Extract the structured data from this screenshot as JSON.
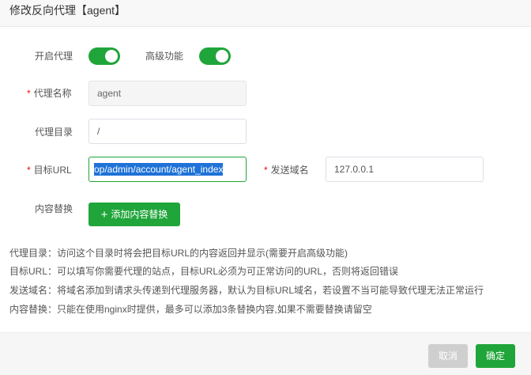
{
  "dialog": {
    "title": "修改反向代理【agent】"
  },
  "form": {
    "enable_proxy": {
      "label": "开启代理",
      "on": true
    },
    "advanced": {
      "label": "高级功能",
      "on": true
    },
    "proxy_name": {
      "label": "代理名称",
      "required_mark": "*",
      "value": "agent"
    },
    "proxy_dir": {
      "label": "代理目录",
      "value": "/"
    },
    "target_url": {
      "label": "目标URL",
      "required_mark": "*",
      "value": "op/admin/account/agent_index"
    },
    "send_domain": {
      "label": "发送域名",
      "required_mark": "*",
      "value": "127.0.0.1"
    },
    "content_replace": {
      "label": "内容替换",
      "add_button": "添加内容替换",
      "add_icon": "+"
    }
  },
  "help": [
    "代理目录：访问这个目录时将会把目标URL的内容返回并显示(需要开启高级功能)",
    "目标URL：可以填写你需要代理的站点，目标URL必须为可正常访问的URL，否则将返回错误",
    "发送域名：将域名添加到请求头传递到代理服务器，默认为目标URL域名，若设置不当可能导致代理无法正常运行",
    "内容替换：只能在使用nginx时提供，最多可以添加3条替换内容,如果不需要替换请留空"
  ],
  "footer": {
    "cancel_label": "取消",
    "confirm_label": "确定"
  },
  "colors": {
    "accent": "#20a53a",
    "required": "#ef0808",
    "selection": "#1f72d8",
    "cancel_bg": "#cfcfcf"
  }
}
